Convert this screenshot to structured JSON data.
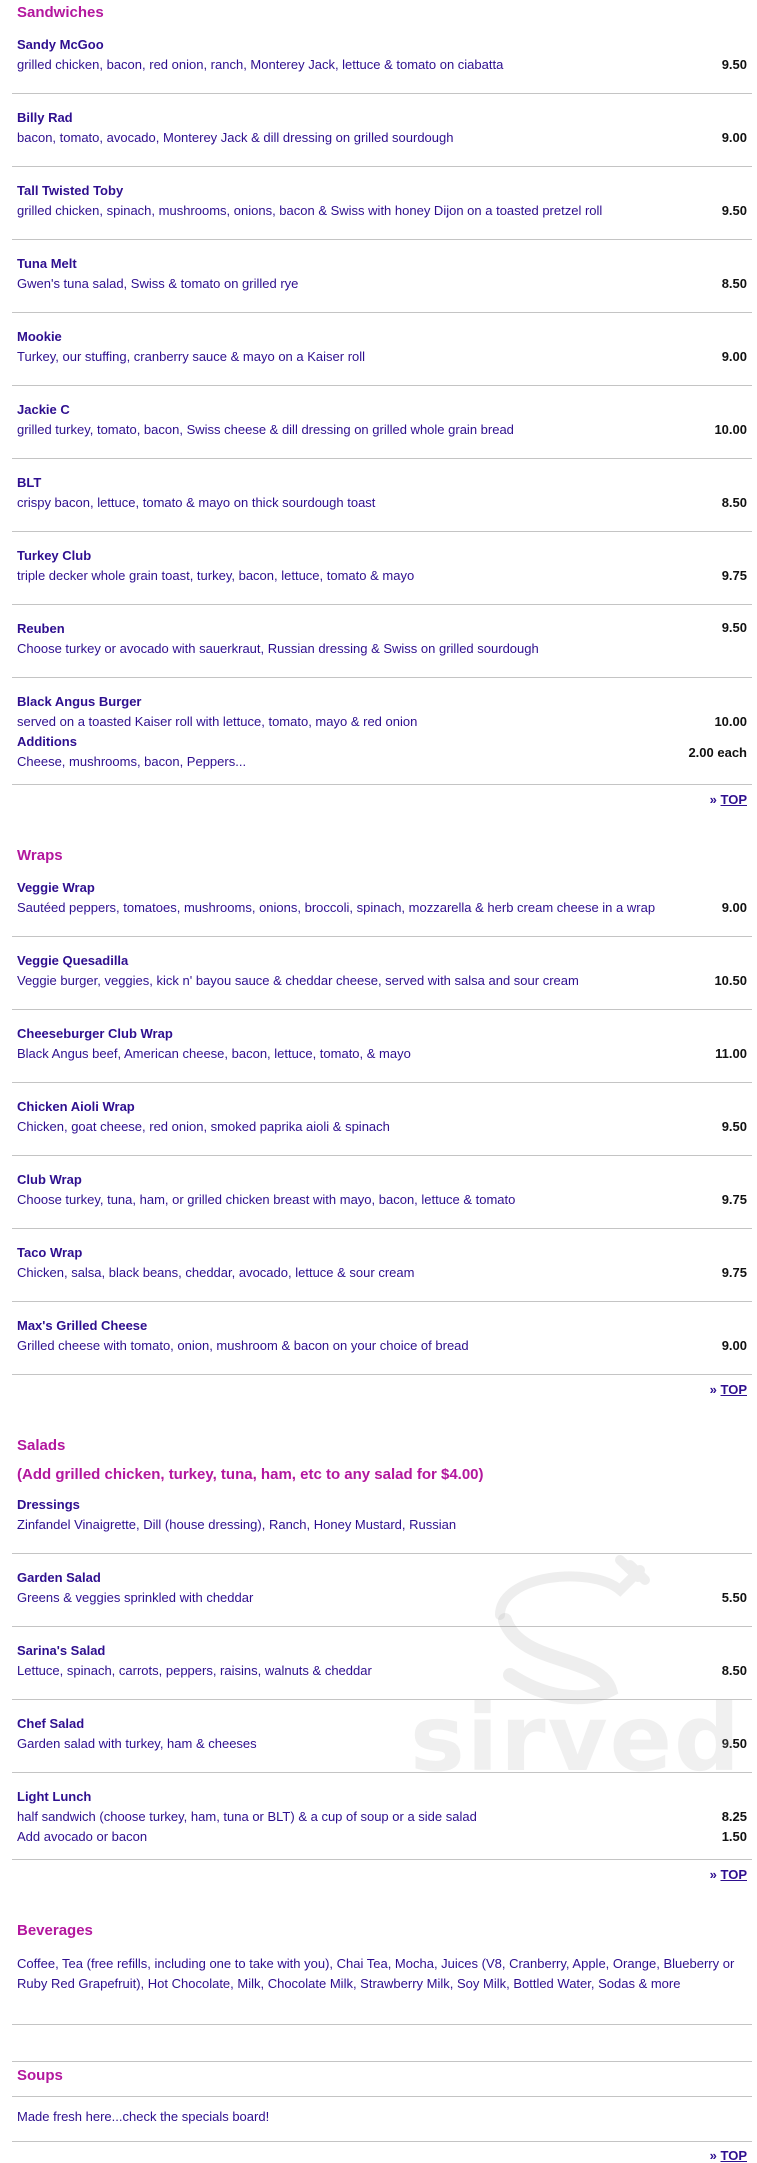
{
  "sandwiches": {
    "title": "Sandwiches",
    "items": [
      {
        "name": "Sandy McGoo",
        "desc": "grilled chicken, bacon, red onion, ranch, Monterey Jack, lettuce & tomato on ciabatta",
        "price": "9.50"
      },
      {
        "name": "Billy Rad",
        "desc": "bacon, tomato, avocado, Monterey Jack & dill dressing on grilled sourdough",
        "price": "9.00"
      },
      {
        "name": "Tall Twisted Toby",
        "desc": "grilled chicken, spinach, mushrooms, onions, bacon & Swiss with honey Dijon on a toasted pretzel roll",
        "price": "9.50"
      },
      {
        "name": "Tuna Melt",
        "desc": "Gwen's tuna salad, Swiss & tomato on grilled rye",
        "price": "8.50"
      },
      {
        "name": "Mookie",
        "desc": "Turkey, our stuffing, cranberry sauce & mayo on a Kaiser roll",
        "price": "9.00"
      },
      {
        "name": "Jackie C",
        "desc": "grilled turkey, tomato, bacon, Swiss cheese & dill dressing on grilled whole grain bread",
        "price": "10.00"
      },
      {
        "name": "BLT",
        "desc": "crispy bacon, lettuce, tomato & mayo on thick sourdough toast",
        "price": "8.50"
      },
      {
        "name": "Turkey Club",
        "desc": "triple decker whole grain toast, turkey, bacon, lettuce, tomato & mayo",
        "price": "9.75"
      }
    ],
    "reuben": {
      "name": "Reuben",
      "desc": "Choose turkey or avocado with sauerkraut, Russian dressing & Swiss on grilled sourdough",
      "price": "9.50"
    },
    "burger": {
      "name": "Black Angus Burger",
      "desc": "served on a toasted Kaiser roll with lettuce, tomato, mayo & red onion",
      "price": "10.00",
      "additions_label": "Additions",
      "additions_desc": "Cheese, mushrooms, bacon, Peppers...",
      "additions_price": "2.00 each"
    },
    "top_prefix": "» ",
    "top_link": "TOP"
  },
  "wraps": {
    "title": "Wraps",
    "items": [
      {
        "name": "Veggie Wrap",
        "desc": "Sautéed peppers, tomatoes, mushrooms, onions, broccoli, spinach, mozzarella & herb cream cheese in a wrap",
        "price": "9.00"
      },
      {
        "name": "Veggie Quesadilla",
        "desc": "Veggie burger, veggies, kick n' bayou sauce & cheddar cheese, served with salsa and sour cream",
        "price": "10.50"
      },
      {
        "name": "Cheeseburger Club Wrap",
        "desc": "Black Angus beef, American cheese, bacon, lettuce, tomato, & mayo",
        "price": "11.00"
      },
      {
        "name": "Chicken Aioli Wrap",
        "desc": "Chicken, goat cheese, red onion, smoked paprika aioli & spinach",
        "price": "9.50"
      },
      {
        "name": "Club Wrap",
        "desc": "Choose turkey, tuna, ham, or grilled chicken breast with mayo, bacon, lettuce & tomato",
        "price": "9.75"
      },
      {
        "name": "Taco Wrap",
        "desc": "Chicken, salsa, black beans, cheddar, avocado, lettuce & sour cream",
        "price": "9.75"
      },
      {
        "name": "Max's Grilled Cheese",
        "desc": "Grilled cheese with tomato, onion, mushroom & bacon on your choice of bread",
        "price": "9.00"
      }
    ],
    "top_prefix": "» ",
    "top_link": "TOP"
  },
  "salads": {
    "title": "Salads",
    "note": "(Add grilled chicken, turkey, tuna, ham, etc to any salad for $4.00)",
    "dressings": {
      "name": "Dressings",
      "desc": "Zinfandel Vinaigrette, Dill (house dressing), Ranch, Honey Mustard, Russian"
    },
    "items": [
      {
        "name": "Garden Salad",
        "desc": "Greens & veggies sprinkled with cheddar",
        "price": "5.50"
      },
      {
        "name": "Sarina's Salad",
        "desc": "Lettuce, spinach, carrots, peppers, raisins, walnuts & cheddar",
        "price": "8.50"
      },
      {
        "name": "Chef Salad",
        "desc": "Garden salad with turkey, ham & cheeses",
        "price": "9.50"
      }
    ],
    "light_lunch": {
      "name": "Light Lunch",
      "desc": "half sandwich (choose turkey, ham, tuna or BLT) & a cup of soup or a side salad",
      "price": "8.25",
      "extra_desc": "Add avocado or bacon",
      "extra_price": "1.50"
    },
    "top_prefix": "» ",
    "top_link": "TOP"
  },
  "beverages": {
    "title": "Beverages",
    "desc": "Coffee, Tea (free refills, including one to take with you), Chai Tea, Mocha, Juices (V8, Cranberry, Apple, Orange, Blueberry or Ruby Red Grapefruit), Hot Chocolate, Milk, Chocolate Milk, Strawberry Milk, Soy Milk, Bottled Water, Sodas & more"
  },
  "soups": {
    "title": "Soups",
    "desc": "Made fresh here...check the specials board!",
    "top_prefix": "» ",
    "top_link": "TOP"
  },
  "watermark": {
    "text": "sirved",
    "icon": "fork-logo-icon",
    "color": "#a0a0a0"
  },
  "colors": {
    "heading": "#b3179e",
    "text": "#2e0f8f",
    "price": "#111111",
    "rule": "#c4c4c4"
  }
}
